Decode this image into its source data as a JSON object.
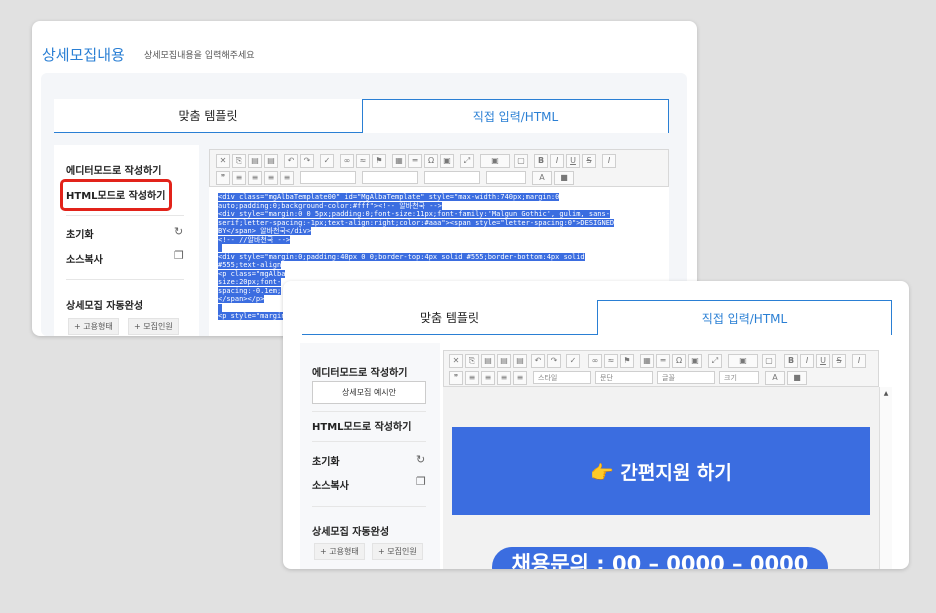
{
  "back": {
    "title": "상세모집내용",
    "subtitle": "상세모집내용을 입력해주세요",
    "tabs": [
      "맞춤 템플릿",
      "직접 입력/HTML"
    ],
    "side": {
      "editor_mode": "에디터모드로 작성하기",
      "html_mode": "HTML모드로 작성하기",
      "reset": "초기화",
      "copy": "소스복사",
      "autocomplete": "상세모집 자동완성",
      "tags": [
        "+ 고용형태",
        "+ 모집인원"
      ]
    },
    "code_lines": [
      "<div class=\"mgAlbaTemplate00\" id=\"MgAlbaTemplate\" style=\"max-width:740px;margin:0",
      "auto;padding:0;background-color:#fff\"><!-- 알바천국 -->",
      "<div style=\"margin:0 0 5px;padding:0;font-size:11px;font-family:'Malgun Gothic', gulim, sans-",
      "serif;letter-spacing:-1px;text-align:right;color:#aaa\"><span style=\"letter-spacing:0\">DESIGNED",
      "BY</span> 알바천국</div>",
      "<!-- //알바천국 -->",
      "",
      "<div style=\"margin:0;padding:40px 0 0;border-top:4px solid #555;border-bottom:4px solid",
      "#555;text-align",
      "<p class=\"mgAlba",
      "size:20px;font-",
      "spacing:-0.1em;",
      "</span></p>",
      "",
      "<p style=\"margin"
    ]
  },
  "front": {
    "tabs": [
      "맞춤 템플릿",
      "직접 입력/HTML"
    ],
    "side": {
      "editor_mode": "에디터모드로 작성하기",
      "example_button": "상세모집 예시안",
      "html_mode": "HTML모드로 작성하기",
      "reset": "초기화",
      "copy": "소스복사",
      "autocomplete": "상세모집 자동완성",
      "tags": [
        "+ 고용형태",
        "+ 모집인원"
      ]
    },
    "toolbar": {
      "style": "스타일",
      "paragraph": "문단",
      "font": "글꼴",
      "size": "크기"
    },
    "banner": "👉 간편지원 하기",
    "pill": "채용문의 : 00 – 0000 – 0000"
  },
  "colors": {
    "accent": "#2a7fd4",
    "banner": "#3b6de0",
    "highlight": "#e2231a"
  }
}
